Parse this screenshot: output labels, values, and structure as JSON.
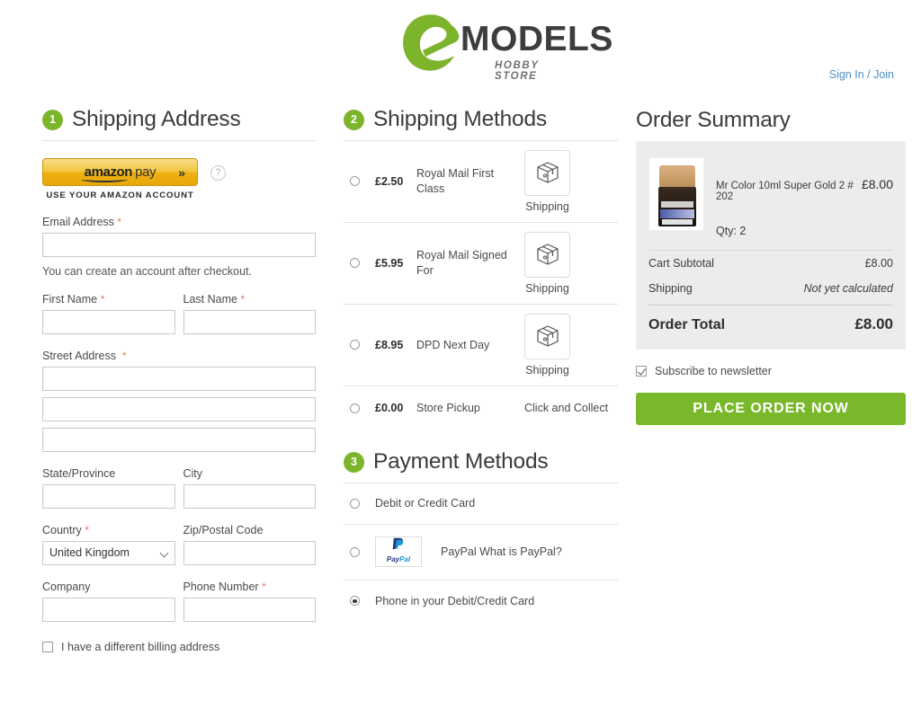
{
  "header": {
    "logo_letter": "e",
    "logo_name": "MODELS",
    "logo_tagline": "HOBBY STORE",
    "signin_label": "Sign In / Join"
  },
  "shipping_address": {
    "step_number": "1",
    "title": "Shipping Address",
    "amazon_pay": {
      "brand": "amazon",
      "pay_word": "pay",
      "chevron": "»",
      "subtitle": "USE YOUR AMAZON ACCOUNT",
      "help_glyph": "?"
    },
    "email_label": "Email Address",
    "email_value": "",
    "email_hint": "You can create an account after checkout.",
    "first_name_label": "First Name",
    "first_name_value": "",
    "last_name_label": "Last Name",
    "last_name_value": "",
    "street_label": "Street Address",
    "street_value_1": "",
    "street_value_2": "",
    "street_value_3": "",
    "state_label": "State/Province",
    "state_value": "",
    "city_label": "City",
    "city_value": "",
    "country_label": "Country",
    "country_value": "United Kingdom",
    "zip_label": "Zip/Postal Code",
    "zip_value": "",
    "company_label": "Company",
    "company_value": "",
    "phone_label": "Phone Number",
    "phone_value": "",
    "billing_checkbox_label": "I have a different billing address",
    "required_marker": "*"
  },
  "shipping_methods": {
    "step_number": "2",
    "title": "Shipping Methods",
    "options": [
      {
        "price": "£2.50",
        "name": "Royal Mail First Class",
        "carrier": "Shipping",
        "has_icon": true,
        "selected": false
      },
      {
        "price": "£5.95",
        "name": "Royal Mail Signed For",
        "carrier": "Shipping",
        "has_icon": true,
        "selected": false
      },
      {
        "price": "£8.95",
        "name": "DPD Next Day",
        "carrier": "Shipping",
        "has_icon": true,
        "selected": false
      },
      {
        "price": "£0.00",
        "name": "Store Pickup",
        "carrier": "Click and Collect",
        "has_icon": false,
        "selected": false
      }
    ]
  },
  "payment_methods": {
    "step_number": "3",
    "title": "Payment Methods",
    "options": [
      {
        "label": "Debit or Credit Card",
        "selected": false,
        "logo": "none"
      },
      {
        "label": "PayPal  What is PayPal?",
        "selected": false,
        "logo": "paypal"
      },
      {
        "label": "Phone in your Debit/Credit Card",
        "selected": true,
        "logo": "none"
      }
    ],
    "paypal_logo_text_1": "Pay",
    "paypal_logo_text_2": "Pal"
  },
  "order_summary": {
    "title": "Order Summary",
    "item": {
      "name": "Mr Color 10ml Super Gold 2 # 202",
      "price": "£8.00",
      "qty_label": "Qty: 2"
    },
    "lines": [
      {
        "label": "Cart Subtotal",
        "value": "£8.00",
        "italic": false
      },
      {
        "label": "Shipping",
        "value": "Not yet calculated",
        "italic": true
      }
    ],
    "total_label": "Order Total",
    "total_value": "£8.00",
    "newsletter_label": "Subscribe to newsletter",
    "newsletter_checked": true,
    "place_order_label": "PLACE ORDER NOW"
  },
  "colors": {
    "brand_green": "#7cb42c",
    "button_green": "#78b82a",
    "link_blue": "#4a90c4",
    "required_red": "#e8796b",
    "summary_bg": "#ececec",
    "amazon_gold": "#eeb211"
  }
}
